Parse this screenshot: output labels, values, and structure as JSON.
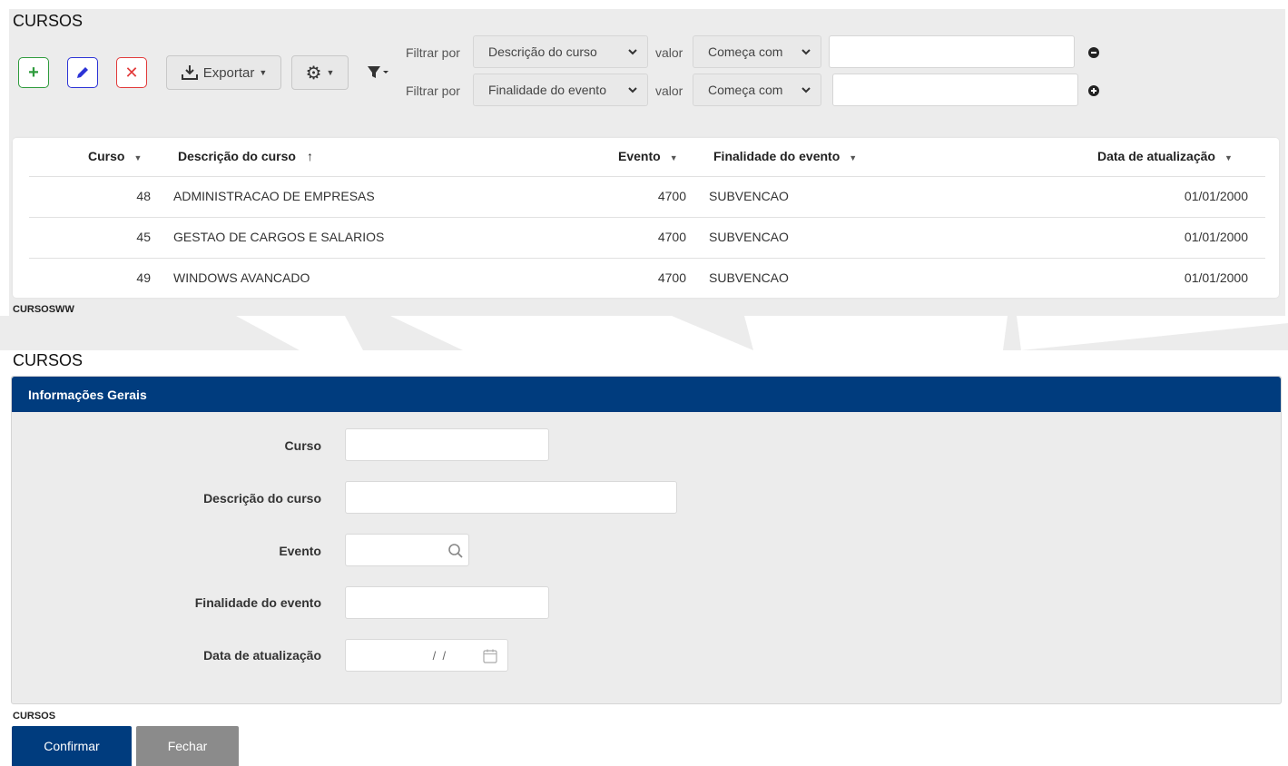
{
  "list_section": {
    "title": "CURSOS",
    "toolbar": {
      "export_label": "Exportar"
    },
    "filters": [
      {
        "label": "Filtrar por",
        "field": "Descrição do curso",
        "value_label": "valor",
        "operator": "Começa com",
        "value": "",
        "action": "remove"
      },
      {
        "label": "Filtrar por",
        "field": "Finalidade do evento",
        "value_label": "valor",
        "operator": "Começa com",
        "value": "",
        "action": "add"
      }
    ],
    "table": {
      "columns": [
        "Curso",
        "Descrição do curso",
        "Evento",
        "Finalidade do evento",
        "Data de atualização"
      ],
      "rows": [
        [
          "48",
          "ADMINISTRACAO DE EMPRESAS",
          "4700",
          "SUBVENCAO",
          "01/01/2000"
        ],
        [
          "45",
          "GESTAO DE CARGOS E SALARIOS",
          "4700",
          "SUBVENCAO",
          "01/01/2000"
        ],
        [
          "49",
          "WINDOWS AVANCADO",
          "4700",
          "SUBVENCAO",
          "01/01/2000"
        ]
      ]
    },
    "footer_code": "CURSOSWW"
  },
  "form_section": {
    "title": "CURSOS",
    "panel_header": "Informações Gerais",
    "fields": [
      {
        "label": "Curso",
        "value": ""
      },
      {
        "label": "Descrição do curso",
        "value": ""
      },
      {
        "label": "Evento",
        "value": ""
      },
      {
        "label": "Finalidade do evento",
        "value": ""
      },
      {
        "label": "Data de atualização",
        "value": " /  /"
      }
    ],
    "footer_code": "CURSOS",
    "buttons": {
      "confirm": "Confirmar",
      "close": "Fechar"
    }
  },
  "colors": {
    "primary": "#003c7e",
    "secondary_button": "#8b8b8b",
    "add": "#2e9b3c",
    "edit": "#2c33d6",
    "delete": "#e23a3a",
    "panel_bg": "#ececec"
  }
}
